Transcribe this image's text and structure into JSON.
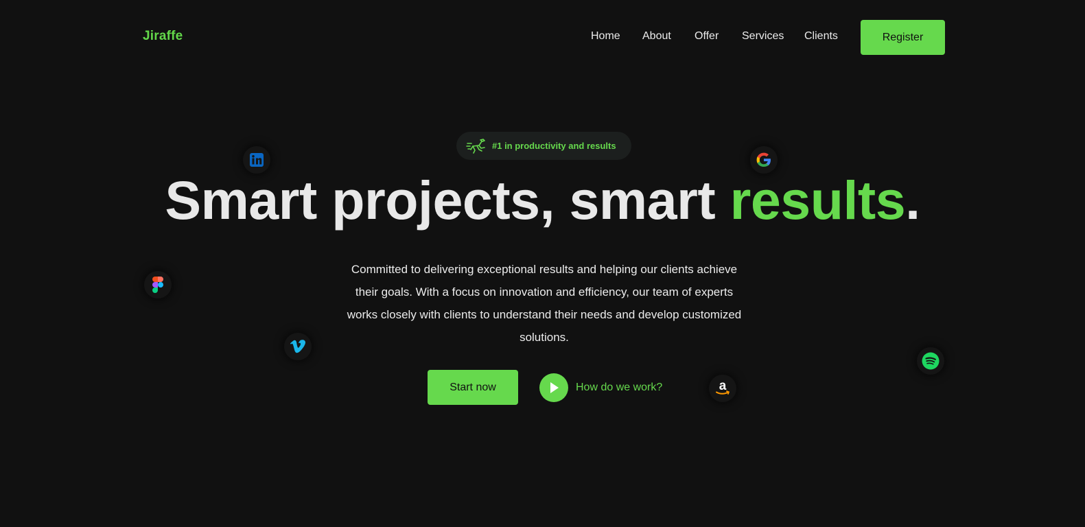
{
  "nav": {
    "logo": "Jiraffe",
    "links": [
      "Home",
      "About",
      "Offer",
      "Services",
      "Clients"
    ],
    "register_label": "Register"
  },
  "hero": {
    "badge_text": "#1 in productivity and results",
    "badge_icon": "running-giraffe-icon",
    "headline_main": "Smart projects, smart ",
    "headline_accent": "results",
    "headline_end": ".",
    "description": "Committed to delivering exceptional results and helping our clients achieve their goals. With a focus on innovation and efficiency, our team of experts works closely with clients to understand their needs and develop customized solutions.",
    "start_label": "Start now",
    "how_label": "How do we work?"
  },
  "floating_icons": [
    "linkedin-icon",
    "google-icon",
    "figma-icon",
    "vimeo-icon",
    "amazon-icon",
    "spotify-icon"
  ],
  "colors": {
    "background": "#111111",
    "accent": "#66d94d",
    "text": "#e8e8e8"
  }
}
